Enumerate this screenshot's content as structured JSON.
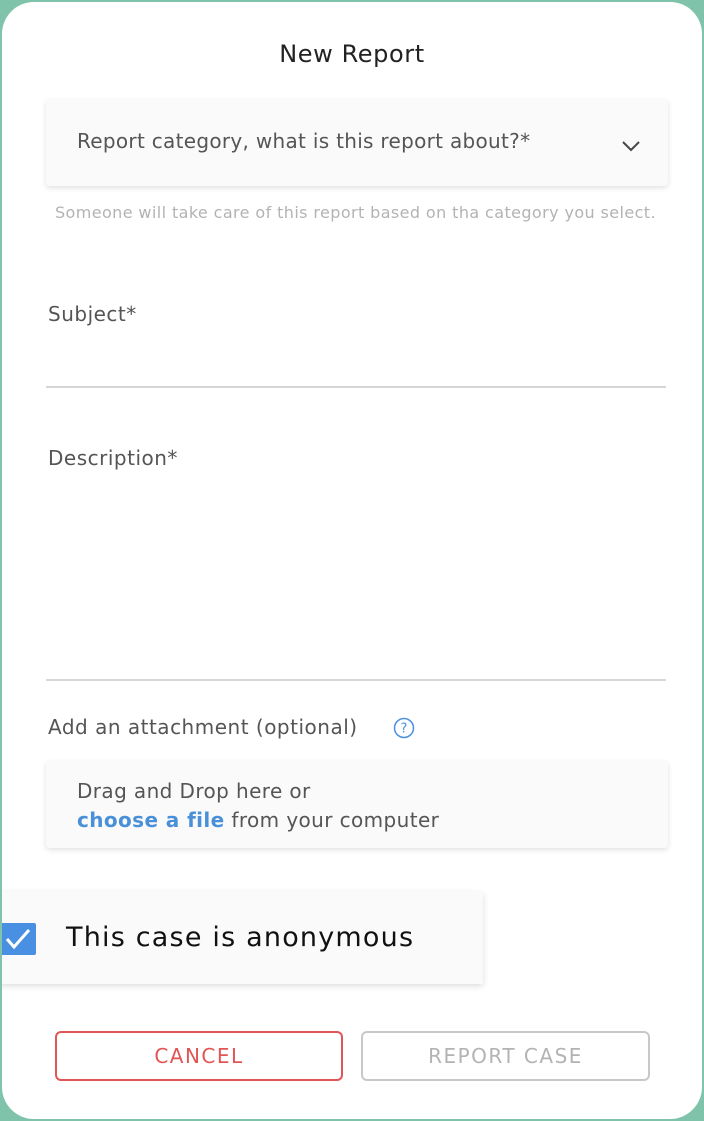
{
  "modal": {
    "title": "New Report"
  },
  "category": {
    "placeholder": "Report category, what is this report about?*",
    "helper": "Someone will take care of this report based on tha category you select."
  },
  "subject": {
    "label": "Subject*",
    "value": ""
  },
  "description": {
    "label": "Description*",
    "value": ""
  },
  "attachment": {
    "label": "Add an attachment (optional)",
    "dropzone_line1": "Drag and Drop here or",
    "dropzone_link": "choose a file",
    "dropzone_suffix": " from your computer"
  },
  "anonymous": {
    "label": "This case is anonymous",
    "checked": true
  },
  "buttons": {
    "cancel": "CANCEL",
    "report": "REPORT CASE"
  },
  "colors": {
    "accent_blue": "#4a90e2",
    "cancel_red": "#e25555",
    "disabled_gray": "#b3b3b3",
    "backdrop_green": "#7fc4aa"
  },
  "icons": {
    "dropdown": "chevron-down-icon",
    "help": "question-circle-icon",
    "checkbox": "checkmark-icon"
  }
}
